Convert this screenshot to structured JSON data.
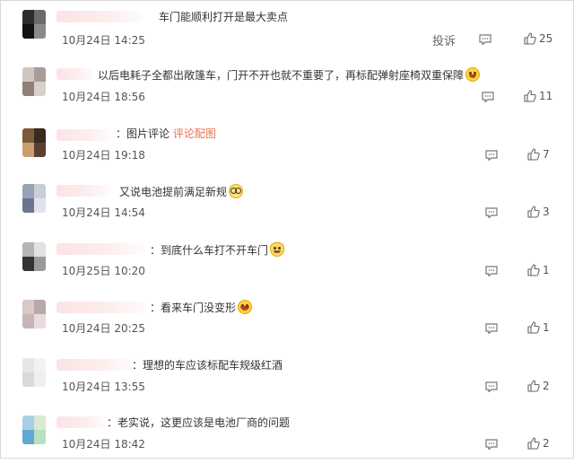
{
  "report_label": "投诉",
  "comments": [
    {
      "text": "车门能顺利打开是最大卖点",
      "time": "10月24日 14:25",
      "likes": "25"
    },
    {
      "text": "以后电耗子全都出敞篷车，门开不开也就不重要了，再标配弹射座椅双重保障",
      "emoji": "laughing-tears-emoji",
      "time": "10月24日 18:56",
      "likes": "11"
    },
    {
      "sep": "：",
      "text": "图片评论",
      "link": "评论配图",
      "time": "10月24日 19:18",
      "likes": "7"
    },
    {
      "text": "又说电池提前满足新规",
      "emoji": "glasses-emoji",
      "time": "10月24日 14:54",
      "likes": "3"
    },
    {
      "sep": "：",
      "text": "到底什么车打不开车门",
      "emoji": "cat-emoji",
      "time": "10月25日 10:20",
      "likes": "1"
    },
    {
      "sep": "：",
      "text": "看来车门没变形",
      "emoji": "grin-emoji",
      "time": "10月24日 20:25",
      "likes": "1"
    },
    {
      "sep": "：",
      "text": "理想的车应该标配车规级红酒",
      "time": "10月24日 13:55",
      "likes": "2"
    },
    {
      "sep": "：",
      "text": "老实说，这更应该是电池厂商的问题",
      "time": "10月24日 18:42",
      "likes": "2"
    }
  ],
  "colors": {
    "link": "#eb7350",
    "name_blur": "#fbe3e4",
    "text": "#333333",
    "meta": "#555555"
  },
  "icons": {
    "comment": "comment-icon",
    "like": "thumbs-up-icon",
    "avatar": "blurred-avatar"
  }
}
